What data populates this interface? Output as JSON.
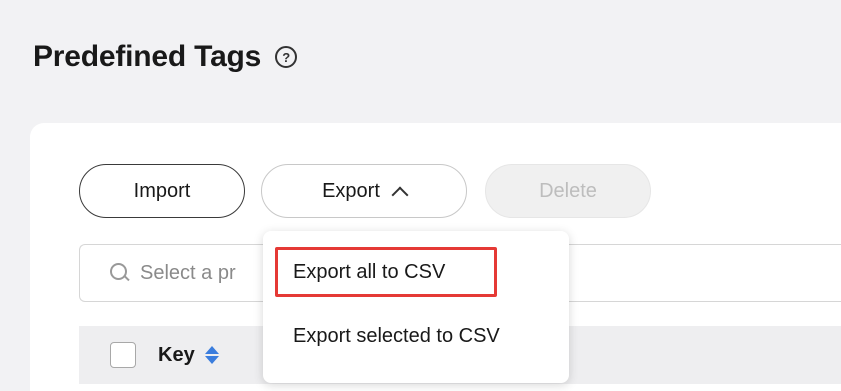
{
  "header": {
    "title": "Predefined Tags",
    "help_icon": "question-circle-icon"
  },
  "toolbar": {
    "import_label": "Import",
    "export_label": "Export",
    "delete_label": "Delete"
  },
  "search": {
    "placeholder": "Select a pr"
  },
  "export_menu": {
    "items": [
      {
        "label": "Export all to CSV",
        "highlighted": true
      },
      {
        "label": "Export selected to CSV"
      }
    ]
  },
  "table": {
    "columns": [
      {
        "label": "Key",
        "sortable": true
      }
    ]
  },
  "colors": {
    "highlight": "#e53935",
    "sort_accent": "#3b7ddd",
    "background": "#f2f2f4"
  }
}
